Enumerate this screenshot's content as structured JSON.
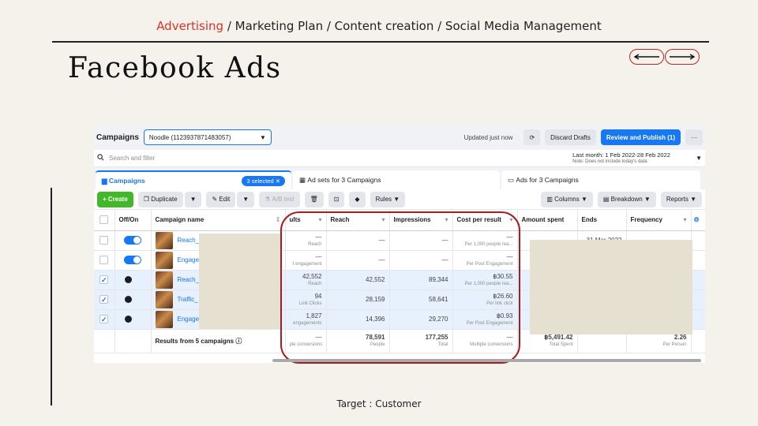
{
  "breadcrumbs": {
    "active": "Advertising",
    "rest": " / Marketing Plan / Content creation / Social Media Management"
  },
  "slide_title": "Facebook Ads",
  "footer": "Target : Customer",
  "colors": {
    "accent": "#d9342b",
    "facebook_blue": "#1877f2",
    "oval": "#a51e22"
  },
  "ads_manager": {
    "title": "Campaigns",
    "account": "Noodle (1123937871483057)",
    "updated": "Updated just now",
    "discard": "Discard Drafts",
    "publish": "Review and Publish (1)",
    "more": "···",
    "search_placeholder": "Search and filter",
    "date_range": "Last month: 1 Feb 2022-28 Feb 2022",
    "date_note": "Note: Does not include today's data",
    "tabs": {
      "campaigns": "Campaigns",
      "selected": "3 selected",
      "ad_sets": "Ad sets for 3 Campaigns",
      "ads": "Ads for 3 Campaigns"
    },
    "toolbar": {
      "create": "+ Create",
      "duplicate": "Duplicate",
      "edit": "Edit",
      "ab_test": "A/B test",
      "rules": "Rules",
      "columns": "Columns",
      "breakdown": "Breakdown",
      "reports": "Reports"
    },
    "columns": [
      "Off/On",
      "Campaign name",
      "ults",
      "Reach",
      "Impressions",
      "Cost per result",
      "Amount spent",
      "Ends",
      "Frequency"
    ],
    "rows": [
      {
        "checked": false,
        "on": true,
        "name": "Reach_",
        "results": "—",
        "results_sub": "Reach",
        "reach": "—",
        "impressions": "—",
        "cost": "—",
        "cost_sub": "Per 1,000 people rea...",
        "amount": "—",
        "ends": "31 Mar 2022",
        "frequency": "—"
      },
      {
        "checked": false,
        "on": true,
        "name": "Engage",
        "results": "—",
        "results_sub": "t engagement",
        "reach": "—",
        "impressions": "—",
        "cost": "—",
        "cost_sub": "Per Post Engagement"
      },
      {
        "checked": true,
        "on": false,
        "name": "Reach_",
        "results": "42,552",
        "results_sub": "Reach",
        "reach": "42,552",
        "impressions": "89,344",
        "cost": "฿30.55",
        "cost_sub": "Per 1,000 people rea..."
      },
      {
        "checked": true,
        "on": false,
        "name": "Traffic_",
        "results": "94",
        "results_sub": "Link Clicks",
        "reach": "28,159",
        "impressions": "58,641",
        "cost": "฿26.60",
        "cost_sub": "Per link click"
      },
      {
        "checked": true,
        "on": false,
        "name": "Engage",
        "results": "1,827",
        "results_sub": "engagements",
        "reach": "14,396",
        "impressions": "29,270",
        "cost": "฿0.93",
        "cost_sub": "Per Post Engagement"
      }
    ],
    "totals": {
      "label": "Results from 5 campaigns",
      "results": "—",
      "results_sub": "ple conversions",
      "reach": "78,591",
      "reach_sub": "People",
      "impressions": "177,255",
      "impressions_sub": "Total",
      "cost": "—",
      "cost_sub": "Multiple conversions",
      "amount": "฿5,491.42",
      "amount_sub": "Total Spent",
      "frequency": "2.26",
      "frequency_sub": "Per Person"
    }
  }
}
